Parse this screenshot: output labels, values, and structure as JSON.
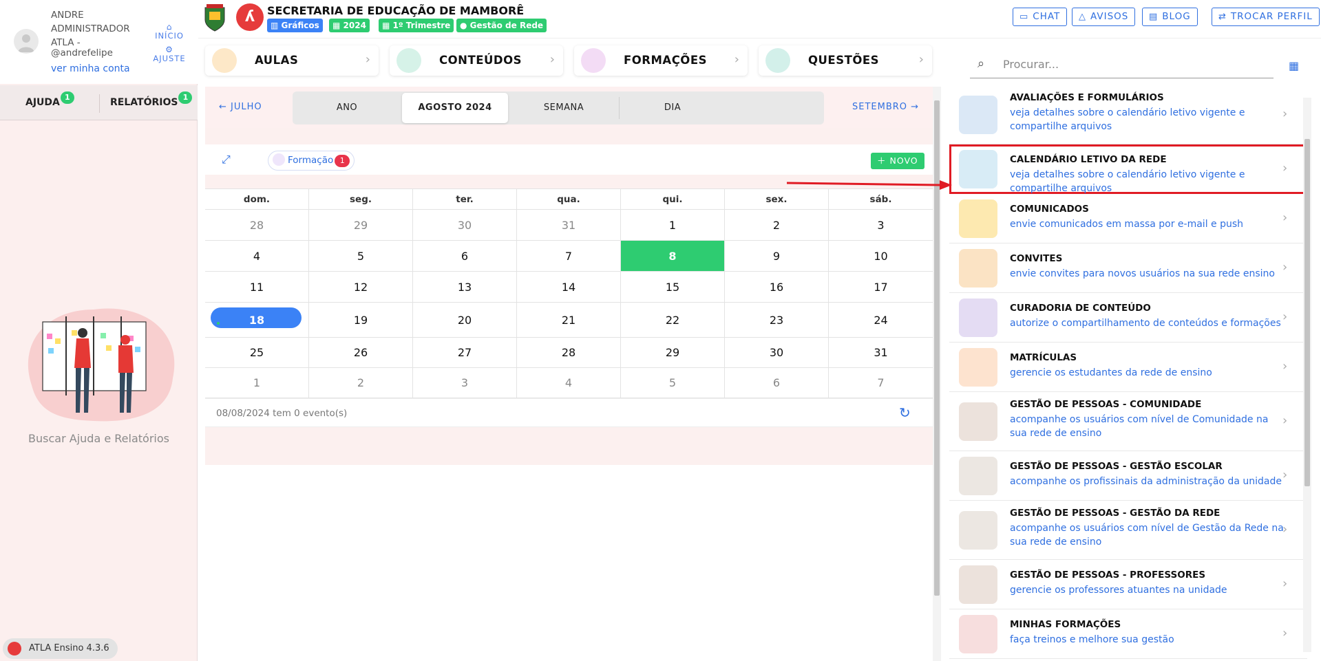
{
  "user": {
    "name": "ANDRE ADMINISTRADOR ATLA -",
    "handle": "@andrefelipe",
    "profile_link": "ver minha conta"
  },
  "sidebar": {
    "inicio_label": "INÍCIO",
    "ajuste_label": "AJUSTE",
    "tabs": [
      {
        "label": "AJUDA",
        "badge": "1"
      },
      {
        "label": "RELATÓRIOS",
        "badge": "1"
      }
    ],
    "empty_caption": "Buscar Ajuda e Relatórios",
    "version": "ATLA Ensino 4.3.6"
  },
  "header": {
    "org_title": "SECRETARIA DE EDUCAÇÃO DE MAMBORÊ",
    "chips": [
      {
        "label": "Gráficos",
        "icon": "chart-icon",
        "color": "#3b82f6"
      },
      {
        "label": "2024",
        "icon": "calendar-icon",
        "color": "#2ecc71"
      },
      {
        "label": "1º Trimestre",
        "icon": "calendar-icon",
        "color": "#2ecc71"
      },
      {
        "label": "Gestão de Rede",
        "icon": "check-circle-icon",
        "color": "#2ecc71"
      }
    ],
    "buttons": {
      "chat": "CHAT",
      "avisos": "AVISOS",
      "blog": "BLOG",
      "trocar": "TROCAR PERFIL"
    }
  },
  "nav_cards": [
    {
      "label": "AULAS"
    },
    {
      "label": "CONTEÚDOS"
    },
    {
      "label": "FORMAÇÕES"
    },
    {
      "label": "QUESTÕES"
    }
  ],
  "calendar": {
    "prev_month": "JULHO",
    "next_month": "SETEMBRO",
    "views": [
      "ANO",
      "AGOSTO 2024",
      "SEMANA",
      "DIA"
    ],
    "active_view": "AGOSTO 2024",
    "filter_label": "Formação",
    "filter_count": "1",
    "new_button": "NOVO",
    "weekdays": [
      "dom.",
      "seg.",
      "ter.",
      "qua.",
      "qui.",
      "sex.",
      "sáb."
    ],
    "weeks": [
      [
        "28",
        "29",
        "30",
        "31",
        "1",
        "2",
        "3"
      ],
      [
        "4",
        "5",
        "6",
        "7",
        "8",
        "9",
        "10"
      ],
      [
        "11",
        "12",
        "13",
        "14",
        "15",
        "16",
        "17"
      ],
      [
        "18",
        "19",
        "20",
        "21",
        "22",
        "23",
        "24"
      ],
      [
        "25",
        "26",
        "27",
        "28",
        "29",
        "30",
        "31"
      ],
      [
        "1",
        "2",
        "3",
        "4",
        "5",
        "6",
        "7"
      ]
    ],
    "selected_day": "8",
    "today_day": "18",
    "summary": "08/08/2024 tem 0 evento(s)"
  },
  "right_panel": {
    "search_placeholder": "Procurar...",
    "items": [
      {
        "title": "AVALIAÇÕES E FORMULÁRIOS",
        "desc": "veja detalhes sobre o calendário letivo vigente e compartilhe arquivos",
        "icon": "evaluation-icon"
      },
      {
        "title": "CALENDÁRIO LETIVO DA REDE",
        "desc": "veja detalhes sobre o calendário letivo vigente e compartilhe arquivos",
        "icon": "calendar-icon",
        "highlighted": true
      },
      {
        "title": "COMUNICADOS",
        "desc": "envie comunicados em massa por e-mail e push",
        "icon": "mail-icon"
      },
      {
        "title": "CONVITES",
        "desc": "envie convites para novos usuários na sua rede ensino",
        "icon": "medal-icon"
      },
      {
        "title": "CURADORIA DE CONTEÚDO",
        "desc": "autorize o compartilhamento de conteúdos e formações",
        "icon": "books-icon"
      },
      {
        "title": "MATRÍCULAS",
        "desc": "gerencie os estudantes da rede de ensino",
        "icon": "students-icon"
      },
      {
        "title": "GESTÃO DE PESSOAS - COMUNIDADE",
        "desc": "acompanhe os usuários com nível de Comunidade na sua rede de ensino",
        "icon": "people-icon"
      },
      {
        "title": "GESTÃO DE PESSOAS - GESTÃO ESCOLAR",
        "desc": "acompanhe os profissinais da administração da unidade",
        "icon": "people-growth-icon"
      },
      {
        "title": "GESTÃO DE PESSOAS - GESTÃO DA REDE",
        "desc": "acompanhe os usuários com nível de Gestão da Rede na sua rede de ensino",
        "icon": "people-growth-icon"
      },
      {
        "title": "GESTÃO DE PESSOAS - PROFESSORES",
        "desc": "gerencie os professores atuantes na unidade",
        "icon": "people-icon"
      },
      {
        "title": "MINHAS FORMAÇÕES",
        "desc": "faça treinos e melhore sua gestão",
        "icon": "certificate-icon"
      }
    ]
  },
  "colors": {
    "accent_blue": "#2f6fe0",
    "green": "#2ecc71",
    "highlight_red": "#e01b24",
    "sidebar_bg": "#fcefee"
  }
}
